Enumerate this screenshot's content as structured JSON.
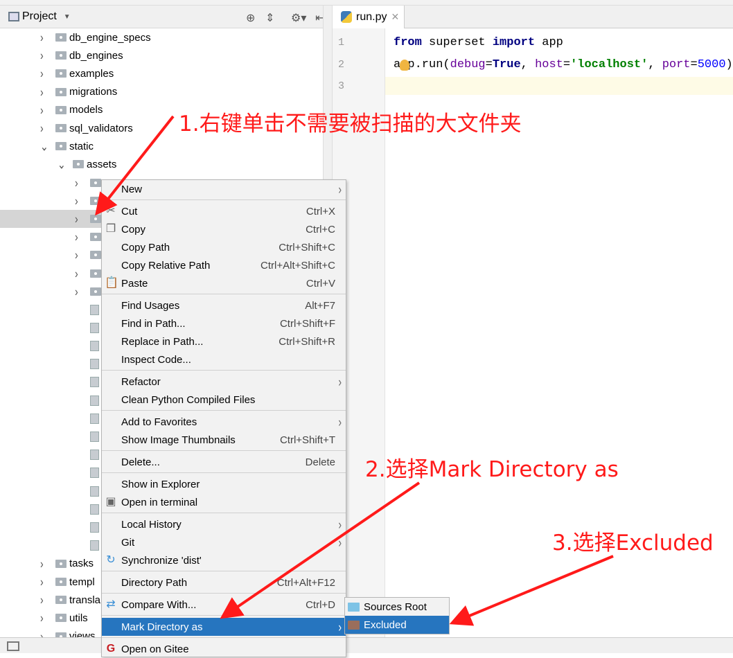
{
  "project_panel": {
    "title": "Project",
    "icons": [
      "locate-icon",
      "collapse-icon",
      "gear-icon",
      "hide-icon"
    ]
  },
  "tree": [
    {
      "label": "db_engine_specs",
      "level": 1,
      "type": "folder"
    },
    {
      "label": "db_engines",
      "level": 1,
      "type": "folder"
    },
    {
      "label": "examples",
      "level": 1,
      "type": "folder"
    },
    {
      "label": "migrations",
      "level": 1,
      "type": "folder"
    },
    {
      "label": "models",
      "level": 1,
      "type": "folder"
    },
    {
      "label": "sql_validators",
      "level": 1,
      "type": "folder"
    },
    {
      "label": "static",
      "level": 1,
      "type": "folder",
      "expanded": true
    },
    {
      "label": "assets",
      "level": 2,
      "type": "folder",
      "expanded": true
    },
    {
      "label": "",
      "level": 3,
      "type": "folder"
    },
    {
      "label": "",
      "level": 3,
      "type": "folder"
    },
    {
      "label": "",
      "level": 3,
      "type": "folder",
      "selected": true
    },
    {
      "label": "",
      "level": 3,
      "type": "folder"
    },
    {
      "label": "",
      "level": 3,
      "type": "folder"
    },
    {
      "label": "",
      "level": 3,
      "type": "folder"
    },
    {
      "label": "",
      "level": 3,
      "type": "folder"
    },
    {
      "label": "",
      "level": 3,
      "type": "file"
    },
    {
      "label": "",
      "level": 3,
      "type": "file"
    },
    {
      "label": "",
      "level": 3,
      "type": "file"
    },
    {
      "label": "",
      "level": 3,
      "type": "file"
    },
    {
      "label": "",
      "level": 3,
      "type": "file"
    },
    {
      "label": "",
      "level": 3,
      "type": "file"
    },
    {
      "label": "",
      "level": 3,
      "type": "file"
    },
    {
      "label": "",
      "level": 3,
      "type": "file"
    },
    {
      "label": "",
      "level": 3,
      "type": "file"
    },
    {
      "label": "",
      "level": 3,
      "type": "file"
    },
    {
      "label": "",
      "level": 3,
      "type": "file"
    },
    {
      "label": "",
      "level": 3,
      "type": "file"
    },
    {
      "label": "",
      "level": 3,
      "type": "file"
    },
    {
      "label": "",
      "level": 3,
      "type": "file"
    },
    {
      "label": "tasks",
      "level": 1,
      "type": "folder"
    },
    {
      "label": "templ",
      "level": 1,
      "type": "folder"
    },
    {
      "label": "transla",
      "level": 1,
      "type": "folder"
    },
    {
      "label": "utils",
      "level": 1,
      "type": "folder"
    },
    {
      "label": "views",
      "level": 1,
      "type": "folder"
    }
  ],
  "editor": {
    "tab": "run.py",
    "line_numbers": [
      "1",
      "2",
      "3"
    ],
    "line1": {
      "kw1": "from",
      "t1": " superset ",
      "kw2": "import",
      "t2": " app"
    },
    "line2": {
      "t1": "app.run(",
      "p1": "debug",
      "t2": "=",
      "kw": "True",
      "t3": ", ",
      "p2": "host",
      "t4": "=",
      "s": "'localhost'",
      "t5": ", ",
      "p3": "port",
      "t6": "=",
      "n": "5000",
      "t7": ")"
    }
  },
  "context_menu": [
    {
      "label": "New",
      "submenu": true
    },
    {
      "sep": true
    },
    {
      "label": "Cut",
      "shortcut": "Ctrl+X",
      "icon": "scissors-icon"
    },
    {
      "label": "Copy",
      "shortcut": "Ctrl+C",
      "icon": "copy-icon"
    },
    {
      "label": "Copy Path",
      "shortcut": "Ctrl+Shift+C"
    },
    {
      "label": "Copy Relative Path",
      "shortcut": "Ctrl+Alt+Shift+C"
    },
    {
      "label": "Paste",
      "shortcut": "Ctrl+V",
      "icon": "paste-icon"
    },
    {
      "sep": true
    },
    {
      "label": "Find Usages",
      "shortcut": "Alt+F7"
    },
    {
      "label": "Find in Path...",
      "shortcut": "Ctrl+Shift+F"
    },
    {
      "label": "Replace in Path...",
      "shortcut": "Ctrl+Shift+R"
    },
    {
      "label": "Inspect Code..."
    },
    {
      "sep": true
    },
    {
      "label": "Refactor",
      "submenu": true
    },
    {
      "label": "Clean Python Compiled Files"
    },
    {
      "sep": true
    },
    {
      "label": "Add to Favorites",
      "submenu": true
    },
    {
      "label": "Show Image Thumbnails",
      "shortcut": "Ctrl+Shift+T"
    },
    {
      "sep": true
    },
    {
      "label": "Delete...",
      "shortcut": "Delete"
    },
    {
      "sep": true
    },
    {
      "label": "Show in Explorer"
    },
    {
      "label": "Open in terminal",
      "icon": "terminal-icon"
    },
    {
      "sep": true
    },
    {
      "label": "Local History",
      "submenu": true
    },
    {
      "label": "Git",
      "submenu": true
    },
    {
      "label": "Synchronize 'dist'",
      "icon": "sync-icon"
    },
    {
      "sep": true
    },
    {
      "label": "Directory Path",
      "shortcut": "Ctrl+Alt+F12"
    },
    {
      "sep": true
    },
    {
      "label": "Compare With...",
      "shortcut": "Ctrl+D",
      "icon": "compare-icon"
    },
    {
      "sep": true
    },
    {
      "label": "Mark Directory as",
      "submenu": true,
      "highlighted": true
    },
    {
      "sep": true
    },
    {
      "label": "Open on Gitee",
      "icon": "gitee-icon"
    }
  ],
  "submenu": [
    {
      "label": "Sources Root",
      "color": "#7ec3e6"
    },
    {
      "label": "Excluded",
      "color": "#9a6e5c",
      "highlighted": true
    }
  ],
  "annotations": {
    "a1": "1.右键单击不需要被扫描的大文件夹",
    "a2": "2.选择Mark Directory as",
    "a3": "3.选择Excluded",
    "color": "#ff1a1a"
  }
}
